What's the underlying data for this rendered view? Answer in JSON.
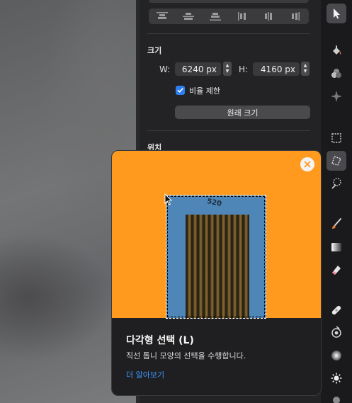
{
  "inspector": {
    "size_section": {
      "title": "크기"
    },
    "width": {
      "label": "W:",
      "value": "6240 px"
    },
    "height": {
      "label": "H:",
      "value": "4160 px"
    },
    "constrain": {
      "label": "비율 제한",
      "checked": true
    },
    "original_size_button": "원래 크기",
    "position_section": {
      "title": "위치"
    }
  },
  "toolbar": {
    "tools": [
      {
        "name": "arrow-tool",
        "active": true
      },
      {
        "name": "paint-bucket-tool",
        "active": false
      },
      {
        "name": "color-adjust-tool",
        "active": false
      },
      {
        "name": "style-tool",
        "active": false
      },
      {
        "name": "rect-select-tool",
        "active": false
      },
      {
        "name": "polygon-select-tool",
        "active": true
      },
      {
        "name": "magic-select-tool",
        "active": false
      },
      {
        "name": "brush-tool",
        "active": false
      },
      {
        "name": "gradient-tool",
        "active": false
      },
      {
        "name": "eraser-tool",
        "active": false
      },
      {
        "name": "heal-tool",
        "active": false
      },
      {
        "name": "clone-tool",
        "active": false
      },
      {
        "name": "blur-tool",
        "active": false
      },
      {
        "name": "lighten-tool",
        "active": false
      }
    ]
  },
  "popover": {
    "door_number": "520",
    "title": "다각형 선택 (L)",
    "description": "직선 톱니 모양의 선택을 수행합니다.",
    "learn_more": "더 알아보기"
  },
  "colors": {
    "accent": "#2c7ef2",
    "link": "#3d96ff",
    "image_orange": "#ff9a1f",
    "door_frame_blue": "#4f86b8"
  }
}
